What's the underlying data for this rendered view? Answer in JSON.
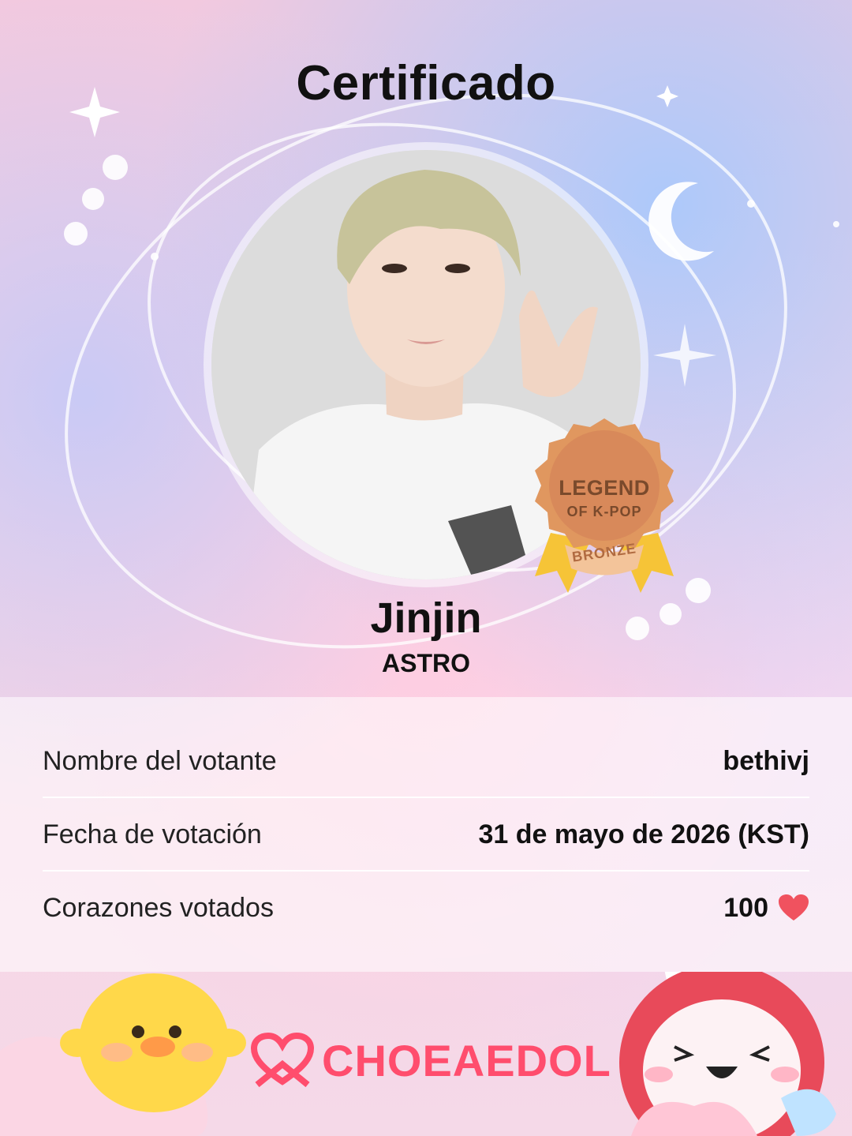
{
  "certificate": {
    "title": "Certificado",
    "idol_name": "Jinjin",
    "group": "ASTRO"
  },
  "badge": {
    "line1": "LEGEND",
    "line2": "OF K-POP",
    "tier": "BRONZE"
  },
  "info": {
    "voter_label": "Nombre del votante",
    "voter_value": "bethivj",
    "date_label": "Fecha de votación",
    "date_value": "31 de mayo de 2026 (KST)",
    "hearts_label": "Corazones votados",
    "hearts_value": "100"
  },
  "brand": {
    "name": "CHOEAEDOL",
    "color": "#ff4d6d"
  },
  "icons": [
    "heart-icon",
    "moon-icon",
    "sparkle-icon",
    "choeaedol-logo-icon",
    "chick-mascot-icon",
    "bunny-mascot-icon"
  ]
}
